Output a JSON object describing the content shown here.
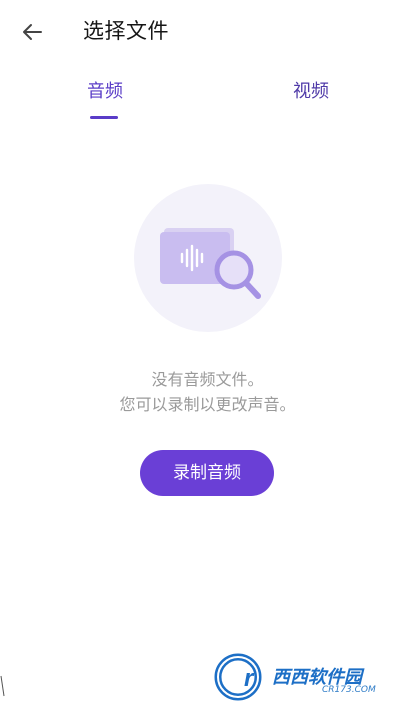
{
  "header": {
    "title": "选择文件",
    "back_icon": "arrow-left-icon"
  },
  "tabs": [
    {
      "label": "音频",
      "selected": true
    },
    {
      "label": "视频",
      "selected": false
    }
  ],
  "empty_state": {
    "illustration_icon": "audio-file-search-icon",
    "line1": "没有音频文件。",
    "line2": "您可以录制以更改声音。"
  },
  "actions": {
    "record_label": "录制音频"
  },
  "watermark": {
    "brand": "西西软件园",
    "site": "CR173.COM"
  },
  "colors": {
    "accent": "#6a3fd6",
    "tab_selected": "#5b3ec7",
    "text_muted": "#9a9a9a",
    "illustration_bg": "#f3f2fa"
  }
}
